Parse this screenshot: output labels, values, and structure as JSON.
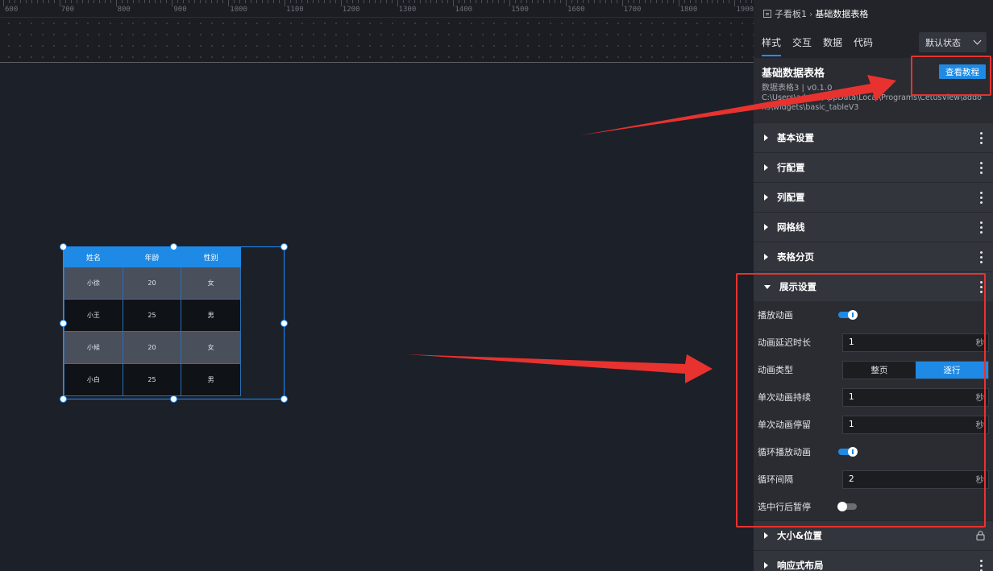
{
  "ruler": {
    "labels": [
      "600",
      "700",
      "800",
      "900",
      "1000",
      "1100",
      "1200",
      "1300",
      "1400",
      "1500",
      "1600",
      "1700",
      "1800",
      "1900"
    ]
  },
  "table": {
    "headers": [
      "姓名",
      "年龄",
      "性别"
    ],
    "rows": [
      [
        "小徐",
        "20",
        "女"
      ],
      [
        "小王",
        "25",
        "男"
      ],
      [
        "小候",
        "20",
        "女"
      ],
      [
        "小白",
        "25",
        "男"
      ]
    ]
  },
  "panel": {
    "breadcrumb": {
      "parent": "子看板1",
      "sep": "›",
      "current": "基础数据表格"
    },
    "tabs": [
      "样式",
      "交互",
      "数据",
      "代码"
    ],
    "state_select": "默认状态",
    "info": {
      "title": "基础数据表格",
      "sub": "数据表格3 | v0.1.0",
      "path": "C:\\Users\\admin\\AppData\\Local\\Programs\\CetusView\\addons\\widgets\\basic_tableV3",
      "tutorial": "查看教程"
    },
    "sections_top": [
      "基本设置",
      "行配置",
      "列配置",
      "网格线",
      "表格分页"
    ],
    "display_section": "展示设置",
    "display": {
      "play_anim": "播放动画",
      "delay_label": "动画延迟时长",
      "delay_value": "1",
      "unit": "秒",
      "type_label": "动画类型",
      "type_options": [
        "整页",
        "逐行"
      ],
      "duration_label": "单次动画持续",
      "duration_value": "1",
      "stay_label": "单次动画停留",
      "stay_value": "1",
      "loop_label": "循环播放动画",
      "interval_label": "循环间隔",
      "interval_value": "2",
      "pause_label": "选中行后暂停"
    },
    "sections_bottom": [
      "大小&位置",
      "响应式布局"
    ]
  },
  "colors": {
    "accent": "#1e8ae5",
    "highlight": "#e8322f"
  }
}
